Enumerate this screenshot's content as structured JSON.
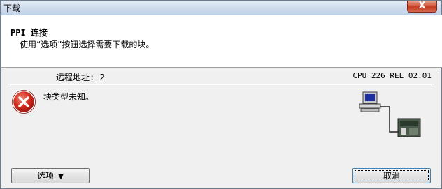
{
  "window": {
    "title": "下载",
    "close_symbol": "X"
  },
  "header": {
    "title": "PPI 连接",
    "subtitle": "使用“选项”按钮选择需要下载的块。"
  },
  "status": {
    "remote_address": "远程地址: 2",
    "cpu_info": "CPU 226 REL 02.01"
  },
  "message": {
    "icon": "error-icon",
    "text": "块类型未知。"
  },
  "graphic": {
    "icon": "pc-to-plc-connection-icon"
  },
  "buttons": {
    "options_label": "选项",
    "options_chevron": "▼",
    "cancel_label": "取消"
  }
}
